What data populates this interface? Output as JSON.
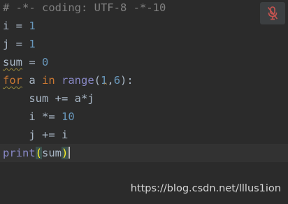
{
  "editor": {
    "comment": "# -*- coding: UTF-8 -*-10",
    "lines": {
      "i_var": "i",
      "i_eq": " = ",
      "i_val": "1",
      "j_var": "j",
      "j_eq": " = ",
      "j_val": "1",
      "sum_var": "sum",
      "sum_eq": " = ",
      "sum_val": "0",
      "for_kw": "for",
      "for_var": " a ",
      "in_kw": "in",
      "range_fn": " range",
      "range_open": "(",
      "range_a": "1",
      "range_comma": ",",
      "range_b": "6",
      "range_close": "):",
      "body1_indent": "    ",
      "body1": "sum += a*j",
      "body2_indent": "    ",
      "body2_code": "i *= ",
      "body2_num": "10",
      "body3_indent": "    ",
      "body3": "j += i",
      "print_fn": "print",
      "print_open": "(",
      "print_arg": "sum",
      "print_close": ")"
    }
  },
  "toolbar": {
    "mic_icon": "mic-muted-icon",
    "mic_color": "#c75450"
  },
  "watermark": "https://blog.csdn.net/lllus1ion"
}
